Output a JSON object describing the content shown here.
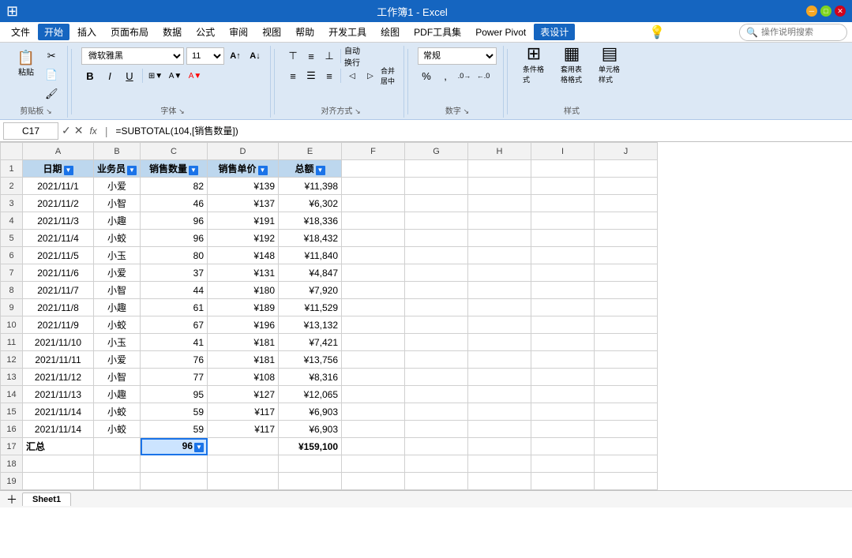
{
  "title": "工作簿1 - Excel",
  "menuBar": {
    "items": [
      "文件",
      "开始",
      "插入",
      "页面布局",
      "数据",
      "公式",
      "审阅",
      "视图",
      "帮助",
      "开发工具",
      "绘图",
      "PDF工具集",
      "Power Pivot",
      "表设计"
    ]
  },
  "ribbon": {
    "activeTab": "表设计",
    "groups": [
      {
        "name": "剪贴板",
        "buttons": [
          {
            "label": "粘贴",
            "icon": "📋"
          },
          {
            "label": "剪切",
            "icon": "✂"
          },
          {
            "label": "复制",
            "icon": "📄"
          },
          {
            "label": "格式刷",
            "icon": "🖌"
          }
        ]
      },
      {
        "name": "字体",
        "fontName": "微软雅黑",
        "fontSize": "11",
        "bold": "B",
        "italic": "I",
        "underline": "U"
      },
      {
        "name": "对齐方式"
      },
      {
        "name": "数字",
        "format": "常规"
      },
      {
        "name": "样式",
        "buttons": [
          "条件格式",
          "套用表格格式",
          "单元格样式"
        ]
      }
    ]
  },
  "formulaBar": {
    "cellRef": "C17",
    "formula": "=SUBTOTAL(104,[销售数量])",
    "fxLabel": "fx"
  },
  "helpSearch": {
    "placeholder": "操作说明搜索"
  },
  "columns": {
    "headers": [
      "",
      "A",
      "B",
      "C",
      "D",
      "E",
      "F",
      "G",
      "H",
      "I",
      "J"
    ],
    "widths": [
      28,
      90,
      55,
      85,
      90,
      80,
      80,
      80,
      80,
      80,
      80
    ]
  },
  "tableHeaders": {
    "row": 1,
    "cells": [
      "日期",
      "业务员",
      "销售数量",
      "销售单价",
      "总额"
    ]
  },
  "tableData": [
    {
      "row": 2,
      "date": "2021/11/1",
      "person": "小爱",
      "qty": 82,
      "price": "¥139",
      "total": "¥11,398"
    },
    {
      "row": 3,
      "date": "2021/11/2",
      "person": "小智",
      "qty": 46,
      "price": "¥137",
      "total": "¥6,302"
    },
    {
      "row": 4,
      "date": "2021/11/3",
      "person": "小趣",
      "qty": 96,
      "price": "¥191",
      "total": "¥18,336"
    },
    {
      "row": 5,
      "date": "2021/11/4",
      "person": "小蛟",
      "qty": 96,
      "price": "¥192",
      "total": "¥18,432"
    },
    {
      "row": 6,
      "date": "2021/11/5",
      "person": "小玉",
      "qty": 80,
      "price": "¥148",
      "total": "¥11,840"
    },
    {
      "row": 7,
      "date": "2021/11/6",
      "person": "小爱",
      "qty": 37,
      "price": "¥131",
      "total": "¥4,847"
    },
    {
      "row": 8,
      "date": "2021/11/7",
      "person": "小智",
      "qty": 44,
      "price": "¥180",
      "total": "¥7,920"
    },
    {
      "row": 9,
      "date": "2021/11/8",
      "person": "小趣",
      "qty": 61,
      "price": "¥189",
      "total": "¥11,529"
    },
    {
      "row": 10,
      "date": "2021/11/9",
      "person": "小蛟",
      "qty": 67,
      "price": "¥196",
      "total": "¥13,132"
    },
    {
      "row": 11,
      "date": "2021/11/10",
      "person": "小玉",
      "qty": 41,
      "price": "¥181",
      "total": "¥7,421"
    },
    {
      "row": 12,
      "date": "2021/11/11",
      "person": "小爱",
      "qty": 76,
      "price": "¥181",
      "total": "¥13,756"
    },
    {
      "row": 13,
      "date": "2021/11/12",
      "person": "小智",
      "qty": 77,
      "price": "¥108",
      "total": "¥8,316"
    },
    {
      "row": 14,
      "date": "2021/11/13",
      "person": "小趣",
      "qty": 95,
      "price": "¥127",
      "total": "¥12,065"
    },
    {
      "row": 15,
      "date": "2021/11/14",
      "person": "小蛟",
      "qty": 59,
      "price": "¥117",
      "total": "¥6,903"
    },
    {
      "row": 16,
      "date": "2021/11/14",
      "person": "小蛟",
      "qty": 59,
      "price": "¥117",
      "total": "¥6,903"
    }
  ],
  "summaryRow": {
    "row": 17,
    "label": "汇总",
    "qty": "96",
    "total": "¥159,100"
  },
  "emptyRows": [
    18,
    19
  ],
  "selectedCell": "C17",
  "sheetTabs": [
    "Sheet1"
  ],
  "activeSheet": "Sheet1",
  "colors": {
    "headerBg": "#bdd7ee",
    "dataBg": "#ddeeff",
    "selectedBg": "#cce4ff",
    "ribbonBg": "#dce8f5",
    "titleBarBg": "#1565c0"
  }
}
